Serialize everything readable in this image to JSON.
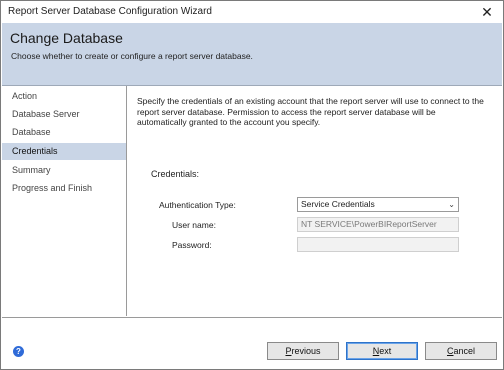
{
  "window": {
    "title": "Report Server Database Configuration Wizard",
    "close_glyph": "✕"
  },
  "header": {
    "title": "Change Database",
    "subtitle": "Choose whether to create or configure a report server database."
  },
  "sidebar": {
    "items": [
      {
        "label": "Action",
        "selected": false
      },
      {
        "label": "Database Server",
        "selected": false
      },
      {
        "label": "Database",
        "selected": false
      },
      {
        "label": "Credentials",
        "selected": true
      },
      {
        "label": "Summary",
        "selected": false
      },
      {
        "label": "Progress and Finish",
        "selected": false
      }
    ]
  },
  "main": {
    "description": "Specify the credentials of an existing account that the report server will use to connect to the report server database.  Permission to access the report server database will be automatically granted to the account you specify.",
    "credentials_label": "Credentials:",
    "auth_type_label": "Authentication Type:",
    "auth_type_value": "Service Credentials",
    "username_label": "User name:",
    "username_value": "NT SERVICE\\PowerBIReportServer",
    "password_label": "Password:",
    "password_value": ""
  },
  "footer": {
    "help_icon": "question-mark-circle",
    "help_glyph": "?",
    "previous_first": "P",
    "previous_rest": "revious",
    "next_first": "N",
    "next_rest": "ext",
    "cancel_first": "C",
    "cancel_rest": "ancel"
  },
  "colors": {
    "header_bg": "#c9d5e6",
    "selected_item_bg": "#c9d5e6",
    "primary_border": "#2e73c9",
    "help_icon": "#2f6bd8"
  }
}
